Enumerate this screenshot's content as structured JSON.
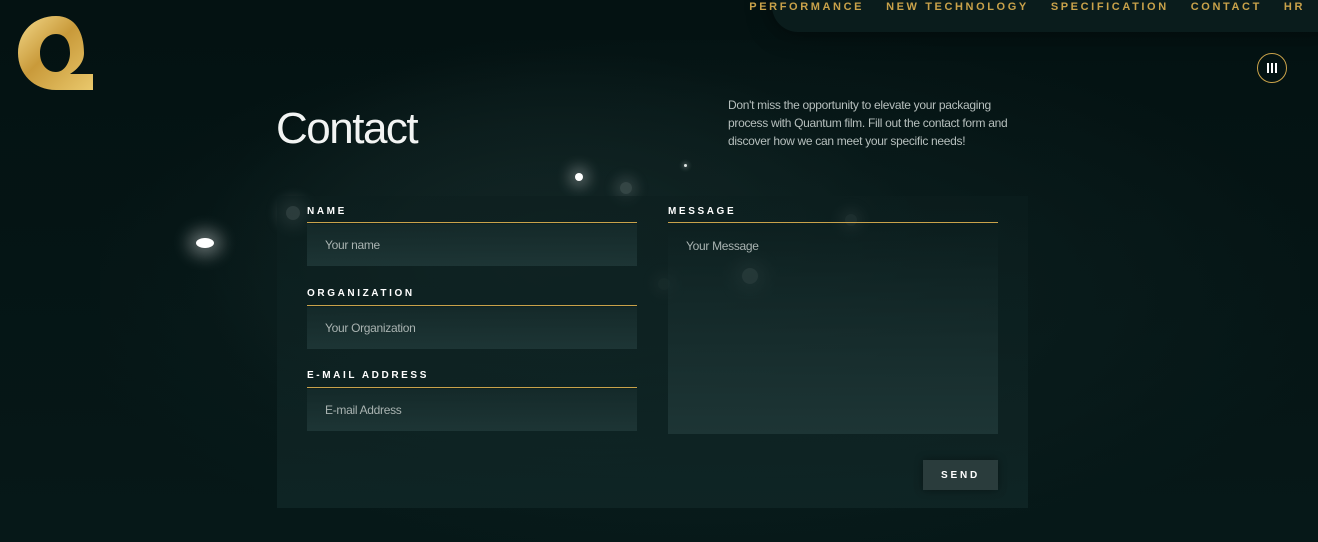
{
  "nav": {
    "items": [
      "PERFORMANCE",
      "NEW TECHNOLOGY",
      "SPECIFICATION",
      "CONTACT",
      "HR"
    ]
  },
  "icons": {
    "logo": "quantum-q-logo-icon",
    "menu": "menu-bars-icon"
  },
  "colors": {
    "accent_gold": "#c9a24a",
    "background": "#051414",
    "text": "#f2f4f3"
  },
  "page": {
    "title": "Contact",
    "intro": "Don't miss the opportunity to elevate your packaging process with Quantum film. Fill out the contact form and discover how we can meet your specific needs!"
  },
  "form": {
    "name": {
      "label": "NAME",
      "placeholder": "Your name"
    },
    "organization": {
      "label": "ORGANIZATION",
      "placeholder": "Your Organization"
    },
    "email": {
      "label": "E-MAIL ADDRESS",
      "placeholder": "E-mail Address"
    },
    "message": {
      "label": "MESSAGE",
      "placeholder": "Your Message"
    },
    "send_label": "SEND"
  }
}
